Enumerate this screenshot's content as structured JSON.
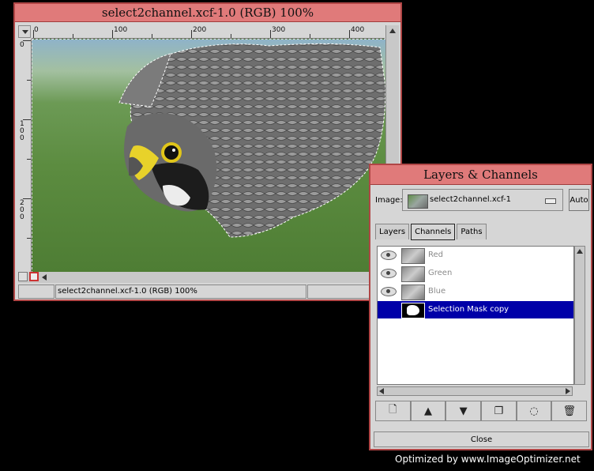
{
  "image_window": {
    "title": "select2channel.xcf-1.0 (RGB) 100%",
    "ruler_h_labels": [
      "0",
      "100",
      "200",
      "300",
      "400"
    ],
    "ruler_v_labels": [
      "0",
      "100",
      "200"
    ],
    "status_text": "select2channel.xcf-1.0 (RGB) 100%"
  },
  "layers_dialog": {
    "title": "Layers & Channels",
    "image_label": "Image:",
    "image_value": "select2channel.xcf-1",
    "auto_label": "Auto",
    "tabs": [
      {
        "label": "Layers"
      },
      {
        "label": "Channels"
      },
      {
        "label": "Paths"
      }
    ],
    "channels": [
      {
        "label": "Red"
      },
      {
        "label": "Green"
      },
      {
        "label": "Blue"
      },
      {
        "label": "Selection Mask copy"
      }
    ],
    "close_label": "Close"
  },
  "watermark": "Optimized by www.ImageOptimizer.net",
  "colors": {
    "titlebar": "#e07a7a",
    "window_border": "#b04646",
    "selection": "#0000a8",
    "panel_bg": "#d6d6d6"
  }
}
